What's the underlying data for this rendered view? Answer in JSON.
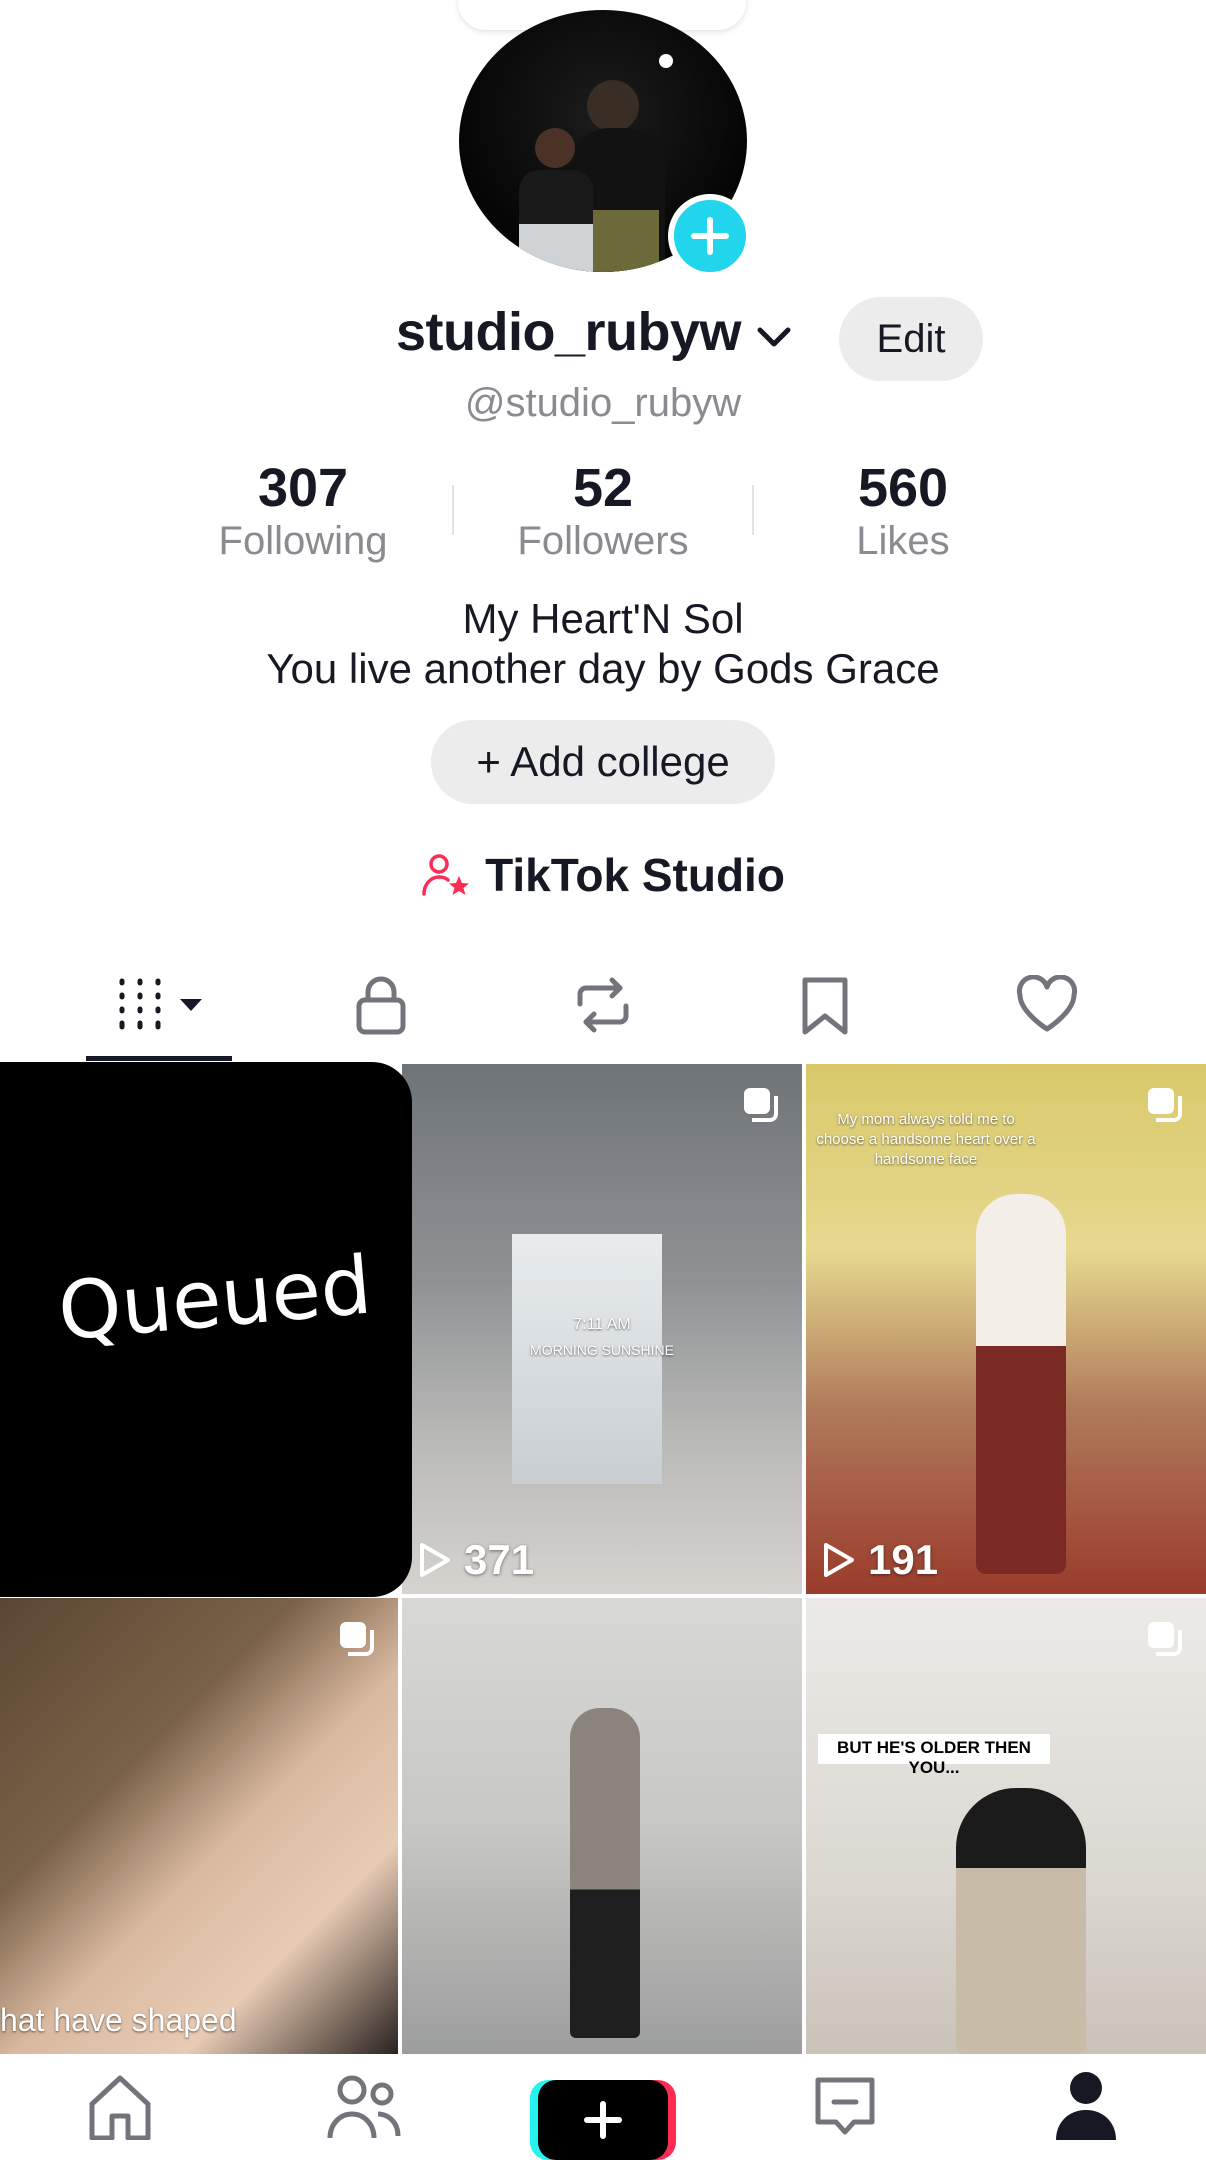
{
  "profile": {
    "display_name": "studio_rubyw",
    "handle": "@studio_rubyw",
    "edit_label": "Edit",
    "bio_line1": "My Heart'N Sol",
    "bio_line2": "You live another day by Gods Grace",
    "add_college_label": "+ Add college",
    "studio_label": "TikTok Studio"
  },
  "stats": [
    {
      "value": "307",
      "label": "Following"
    },
    {
      "value": "52",
      "label": "Followers"
    },
    {
      "value": "560",
      "label": "Likes"
    }
  ],
  "tabs": [
    "grid-icon",
    "lock-icon",
    "repost-icon",
    "bookmark-icon",
    "heart-icon"
  ],
  "videos": [
    {
      "status": "Queued"
    },
    {
      "overlay_time": "7:11 AM",
      "overlay_caption": "MORNING SUNSHINE",
      "views": "371"
    },
    {
      "overlay_caption": "My mom always told me to choose a handsome heart over a handsome face",
      "views": "191"
    },
    {
      "overlay_caption": "hat have shaped"
    },
    {},
    {
      "overlay_caption": "BUT HE'S OLDER THEN YOU..."
    }
  ],
  "bottom_nav": [
    "home-icon",
    "friends-icon",
    "create-icon",
    "inbox-icon",
    "profile-icon"
  ],
  "colors": {
    "accent_cyan": "#20d5ec",
    "accent_pink": "#fe2c55",
    "secondary_text": "#8a8b91"
  }
}
